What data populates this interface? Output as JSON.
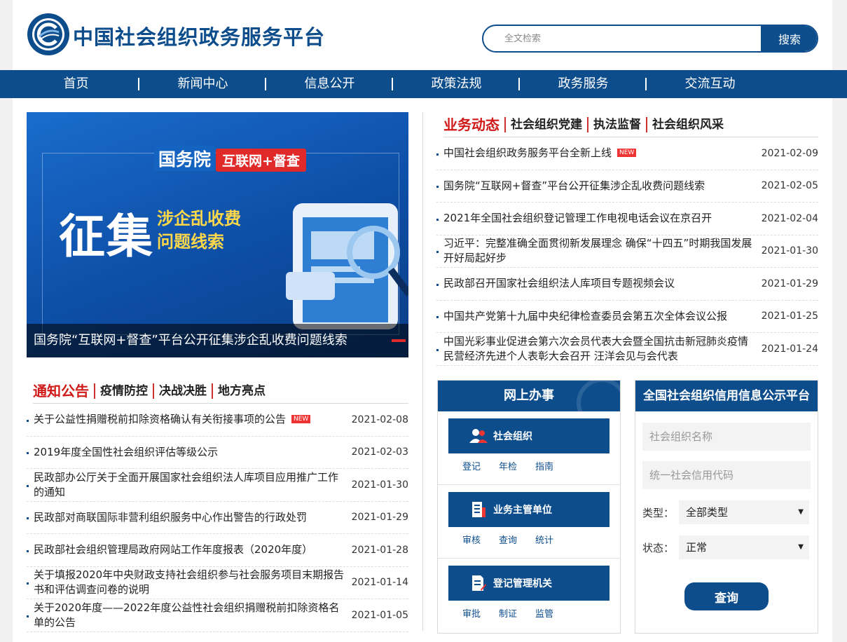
{
  "header": {
    "logo_text": "中国社会组织",
    "site_title": "中国社会组织政务服务平台",
    "search_placeholder": "全文检索",
    "search_button": "搜索"
  },
  "nav": [
    "首页",
    "新闻中心",
    "信息公开",
    "政策法规",
    "政务服务",
    "交流互动"
  ],
  "banner": {
    "head": "国务院",
    "tag": "互联网+督查",
    "big": "征集",
    "sub_line1": "涉企乱收费",
    "sub_line2": "问题线索",
    "caption": "国务院“互联网+督查”平台公开征集涉企乱收费问题线索"
  },
  "business": {
    "tabs": [
      "业务动态",
      "社会组织党建",
      "执法监督",
      "社会组织风采"
    ],
    "items": [
      {
        "title": "中国社会组织政务服务平台全新上线",
        "date": "2021-02-09",
        "new": "NEW"
      },
      {
        "title": "国务院“互联网+督查”平台公开征集涉企乱收费问题线索",
        "date": "2021-02-05"
      },
      {
        "title": "2021年全国社会组织登记管理工作电视电话会议在京召开",
        "date": "2021-02-04"
      },
      {
        "title": "习近平：完整准确全面贯彻新发展理念 确保“十四五”时期我国发展开好局起好步",
        "date": "2021-01-30"
      },
      {
        "title": "民政部召开国家社会组织法人库项目专题视频会议",
        "date": "2021-01-29"
      },
      {
        "title": "中国共产党第十九届中央纪律检查委员会第五次全体会议公报",
        "date": "2021-01-25"
      },
      {
        "title": "中国光彩事业促进会第六次会员代表大会暨全国抗击新冠肺炎疫情民营经济先进个人表彰大会召开 汪洋会见与会代表",
        "date": "2021-01-24"
      }
    ]
  },
  "notice": {
    "tabs": [
      "通知公告",
      "疫情防控",
      "决战决胜",
      "地方亮点"
    ],
    "items": [
      {
        "title": "关于公益性捐赠税前扣除资格确认有关衔接事项的公告",
        "date": "2021-02-08",
        "new": "NEW"
      },
      {
        "title": "2019年度全国性社会组织评估等级公示",
        "date": "2021-02-03"
      },
      {
        "title": "民政部办公厅关于全面开展国家社会组织法人库项目应用推广工作的通知",
        "date": "2021-01-30"
      },
      {
        "title": "民政部对商联国际非营利组织服务中心作出警告的行政处罚",
        "date": "2021-01-29"
      },
      {
        "title": "民政部社会组织管理局政府网站工作年度报表（2020年度）",
        "date": "2021-01-28"
      },
      {
        "title": "关于填报2020年中央财政支持社会组织参与社会服务项目末期报告书和评估调查问卷的说明",
        "date": "2021-01-14"
      },
      {
        "title": "关于2020年度——2022年度公益性社会组织捐赠税前扣除资格名单的公告",
        "date": "2021-01-05"
      }
    ]
  },
  "online": {
    "title": "网上办事",
    "blocks": [
      {
        "label": "社会组织",
        "icon": "users-icon",
        "links": [
          "登记",
          "年检",
          "指南"
        ]
      },
      {
        "label": "业务主管单位",
        "icon": "building-icon",
        "links": [
          "审核",
          "查询",
          "统计"
        ]
      },
      {
        "label": "登记管理机关",
        "icon": "document-edit-icon",
        "links": [
          "审批",
          "制证",
          "监管"
        ]
      }
    ]
  },
  "credit": {
    "title": "全国社会组织信用信息公示平台",
    "name_placeholder": "社会组织名称",
    "code_placeholder": "统一社会信用代码",
    "type_label": "类型：",
    "type_value": "全部类型",
    "status_label": "状态：",
    "status_value": "正常",
    "query_button": "查询"
  },
  "colors": {
    "brand": "#0d4d8c",
    "accent_red": "#d01919"
  }
}
